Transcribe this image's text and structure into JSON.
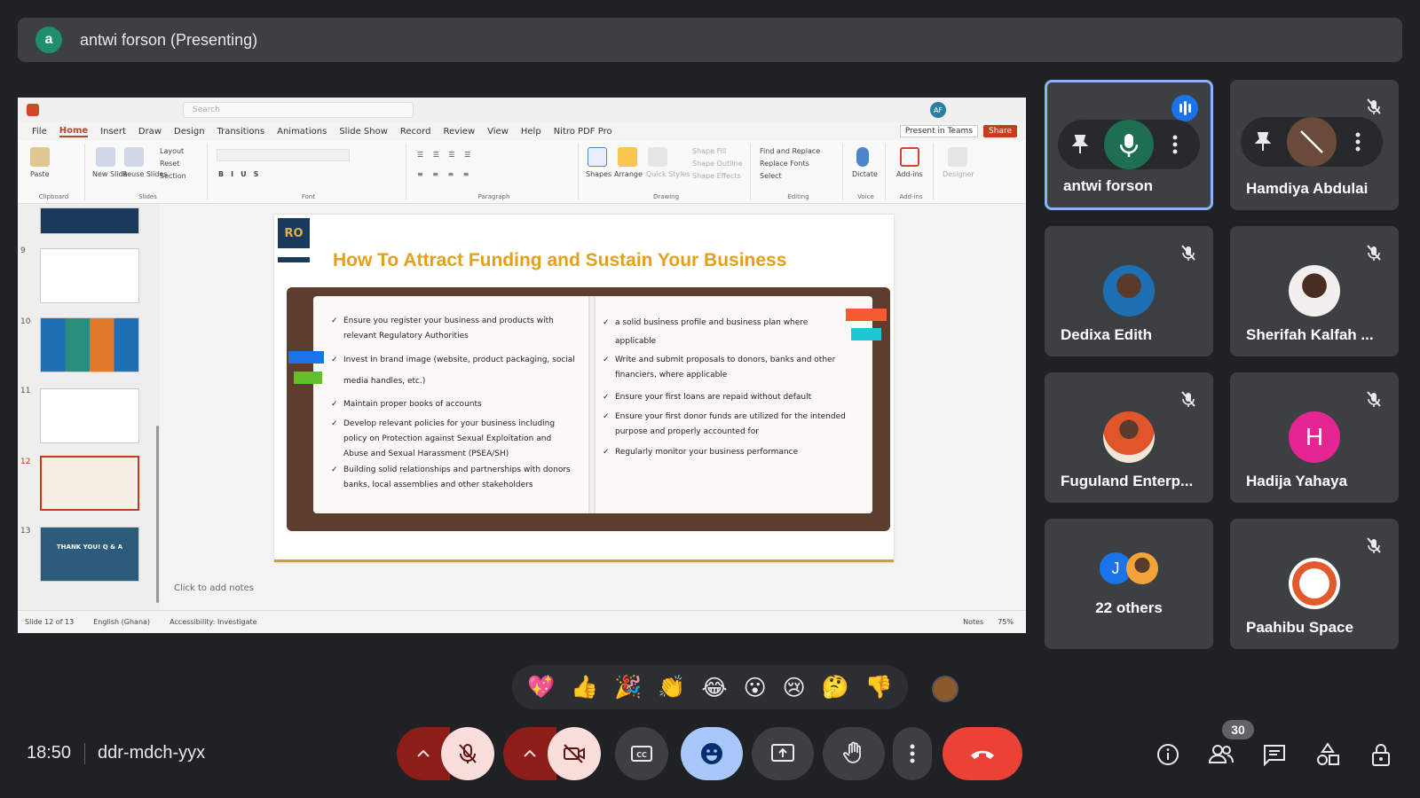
{
  "banner": {
    "avatar_letter": "a",
    "presenter": "antwi forson (Presenting)"
  },
  "ppt": {
    "search_placeholder": "Search",
    "user_initials": "AF",
    "menu": [
      "File",
      "Home",
      "Insert",
      "Draw",
      "Design",
      "Transitions",
      "Animations",
      "Slide Show",
      "Record",
      "Review",
      "View",
      "Help",
      "Nitro PDF Pro"
    ],
    "present_in_teams": "Present in Teams",
    "share": "Share",
    "ribbon": {
      "paste": "Paste",
      "new_slide": "New Slide",
      "reuse_slides": "Reuse Slides",
      "layout": "Layout",
      "reset": "Reset",
      "section": "Section",
      "shapes": "Shapes",
      "arrange": "Arrange",
      "quick_styles": "Quick Styles",
      "shape_fill": "Shape Fill",
      "shape_outline": "Shape Outline",
      "shape_effects": "Shape Effects",
      "find_replace": "Find and Replace",
      "replace_fonts": "Replace Fonts",
      "select": "Select",
      "dictate": "Dictate",
      "addins": "Add-ins",
      "designer": "Designer",
      "groups": {
        "clipboard": "Clipboard",
        "slides": "Slides",
        "font": "Font",
        "paragraph": "Paragraph",
        "drawing": "Drawing",
        "editing": "Editing",
        "voice": "Voice",
        "addins": "Add-ins"
      }
    },
    "thumbs": [
      {
        "num": ""
      },
      {
        "num": "9"
      },
      {
        "num": "10"
      },
      {
        "num": "11"
      },
      {
        "num": "12"
      },
      {
        "num": "13",
        "text": "THANK YOU! Q & A"
      }
    ],
    "slide": {
      "logo": "RO",
      "title": "How To Attract Funding and Sustain Your Business",
      "left_points": [
        "Ensure you register your business and products  with relevant Regulatory Authorities",
        "Invest in brand image (website, product packaging, social media handles, etc.)",
        "Maintain proper books of accounts",
        "Develop relevant policies for your business including policy on Protection against  Sexual Exploitation and Abuse and Sexual Harassment (PSEA/SH)",
        "Building solid relationships and partnerships with donors banks, local assemblies and other stakeholders"
      ],
      "right_points": [
        "a solid business profile and business plan where applicable",
        "Write and submit proposals to donors, banks and other financiers, where applicable",
        "Ensure your first loans are repaid without default",
        "Ensure your first donor funds are utilized for the intended purpose and properly accounted for",
        "Regularly monitor your business performance"
      ]
    },
    "notes_placeholder": "Click to add notes",
    "status": {
      "slide": "Slide 12 of 13",
      "language": "English (Ghana)",
      "accessibility": "Accessibility: Investigate",
      "notes": "Notes",
      "zoom": "75%"
    }
  },
  "participants": [
    {
      "name": "antwi forson",
      "active": true
    },
    {
      "name": "Hamdiya Abdulai"
    },
    {
      "name": "Dedixa Edith"
    },
    {
      "name": "Sherifah Kalfah ..."
    },
    {
      "name": "Fuguland Enterp..."
    },
    {
      "name": "Hadija Yahaya",
      "initial": "H"
    },
    {
      "name": "22 others",
      "initial": "J"
    },
    {
      "name": "Paahibu Space"
    }
  ],
  "reactions": [
    "💖",
    "👍",
    "🎉",
    "👏",
    "😂",
    "😮",
    "😢",
    "🤔",
    "👎"
  ],
  "bottom": {
    "time": "18:50",
    "meeting_code": "ddr-mdch-yyx",
    "people_count": "30"
  },
  "colors": {
    "accent": "#8ab4f8",
    "danger": "#ea4335",
    "slide_title": "#e5a019"
  }
}
